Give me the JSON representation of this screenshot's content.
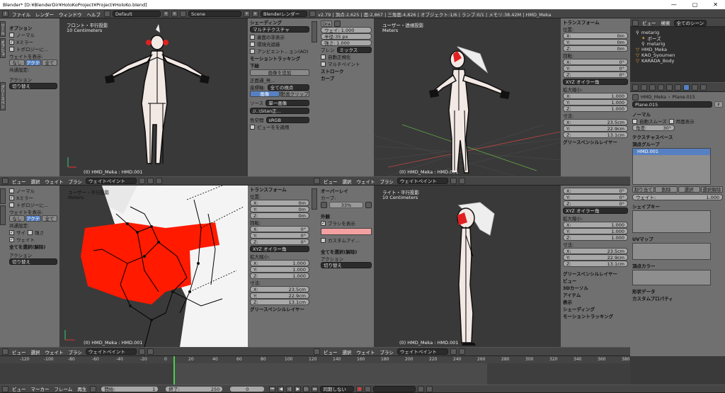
{
  "titlebar": {
    "title": "Blender* [D:¥BlenderDir¥HoloKoProject¥Project¥HoloKo.blend]"
  },
  "infobar": {
    "menus": [
      "ファイル",
      "レンダー",
      "ウィンドウ",
      "ヘルプ"
    ],
    "layout": "Default",
    "scene": "Scene",
    "engine": "Blenderレンダー",
    "stats": "v2.79 | 頂点:2,625 | 面:2,867 | 三角面:4,826 | オブジェクト:1/6 | ランプ:0/1 | メモリ:38.42M | HMD_Meka"
  },
  "tl_tools": {
    "tabs": [
      "ツール",
      "オプション",
      "グリースペンシル"
    ],
    "sec_options": "オプション",
    "normal": "ノーマル",
    "x_mirror": "Xミラー",
    "topology": "トポロジーに...",
    "weight_show": "ウェイトを表示:",
    "none": "なし",
    "active": "アクティブ",
    "all": "全て",
    "common": "共通設定:",
    "action": "アクション",
    "toggle": "切り替え"
  },
  "tl_view": {
    "title": "フロント・平行投影",
    "scale": "10 Centimeters",
    "obj": "(0) HMD_Meka : HMD.001"
  },
  "tm_tools": {
    "shading": "シェーディング",
    "multitex": "マルチテクスチャ",
    "backface": "裏面の非表示",
    "env": "環境光遮蔽",
    "ao": "アンビエント...ョン(AO)",
    "motion": "モーショントラッキング",
    "bg": "下絵",
    "add_image": "画像を追加",
    "front": "正面通_亮...",
    "axis": "座標軸:",
    "allview": "全ての視点",
    "img": "画像",
    "clip": "動画クリップ",
    "source": "ソース",
    "single": "単一画像",
    "path": "//..\\Sitan正...",
    "colorspace": "色空間",
    "srgb": "sRGB",
    "viewtransform": "ビューをを適用"
  },
  "tr_tools": {
    "d_label": "Dra",
    "weight": "ウェイ: 1.000",
    "radius": "半径:35 px",
    "strength": "強さ: 1.000",
    "blend": "ブレン",
    "mix": "ミックス",
    "auto_norm": "自動正規化",
    "multipaint": "マルチペイント",
    "stroke": "ストローク",
    "curve": "カーブ"
  },
  "tr_view": {
    "title": "ユーザー・透視投影",
    "scale": "Meters",
    "obj": "(0) HMD_Meka : HMD.001"
  },
  "bl_view": {
    "title": "ユーザー・平行投影",
    "scale": "Meters",
    "obj": "(0) HMD_Meka : HMD.001"
  },
  "br_view": {
    "title": "ライト・平行投影",
    "scale": "10 Centimeters",
    "obj": "(0) HMD_Meka : HMD.001"
  },
  "bl_tools": {
    "normal": "ノーマル",
    "x_mirror": "Xミラー",
    "topology": "トポロジーに...",
    "weight_show": "ウェイトを表示:",
    "none": "なし",
    "active": "アクティブ",
    "all": "全て",
    "common": "共通設定:",
    "size": "サイ",
    "strength": "強さ",
    "weight": "ウェイト",
    "select_all": "全てを選択(解除)",
    "action": "アクション",
    "toggle": "切り替え"
  },
  "br_tools": {
    "overlay": "オーバーレイ",
    "curve": "カーブ:",
    "pct": "33%",
    "appearance": "外観",
    "show_brush": "ブラシを表示",
    "custom_icon": "カスタムアイ...",
    "select_all": "全てを選択(解除)",
    "action": "アクション",
    "toggle": "切り替え"
  },
  "tf_upper": {
    "title": "トランスフォーム",
    "location": "位置:",
    "x": "0m",
    "y": "0m",
    "z": "0m",
    "rotation": "回転:",
    "rx": "0°",
    "ry": "0°",
    "rz": "0°",
    "mode": "XYZ オイラー角",
    "scale": "拡大縮小:",
    "sx": "1.000",
    "sy": "1.000",
    "sz": "1.000",
    "dims": "寸法:",
    "dx": "23.5cm",
    "dy": "22.9cm",
    "dz": "13.1cm",
    "gp": "グリースペンシルレイヤー"
  },
  "tf_lower": {
    "gp": "グリースペンシルレイヤー",
    "view": "ビュー",
    "cursor": "3Dカーソル",
    "item": "アイテム",
    "display": "表示",
    "shading": "シェーディング",
    "motion": "モーショントラッキング"
  },
  "viewport_hdr": {
    "menus": [
      "ビュー",
      "選択",
      "ウェイト",
      "ブラシ"
    ],
    "mode": "ウェイトペイント"
  },
  "outliner": {
    "view": "ビュー",
    "search": "検索",
    "all_scenes": "全てのシーン",
    "items": [
      "metarig",
      "ポーズ",
      "metarig",
      "HMD_Meka",
      "KAO_Syoumen",
      "KARADA_Body"
    ]
  },
  "props": {
    "obj": "HMD_Meka",
    "mesh": "Plane.015",
    "meshname": "Plane.015",
    "normal": "ノーマル",
    "autosmooth": "自動スムーズ",
    "double": "両面表示",
    "angle": "角度:",
    "angle_val": "30°",
    "texspace": "テクスチャスペース",
    "vgroups": "頂点グループ",
    "vg_item": "HMD.001",
    "assign": "割り当て",
    "remove": "削除",
    "select": "選択",
    "deselect": "選択解除",
    "weight": "ウェイト:",
    "weight_val": "1.000",
    "shapekeys": "シェイプキー",
    "uvmaps": "UVマップ",
    "vcolors": "頂点カラー",
    "geodata": "形状データ",
    "custom": "カスタムプロパティ"
  },
  "timeline": {
    "ticks": [
      "-120",
      "-100",
      "-80",
      "-60",
      "-40",
      "-20",
      "0",
      "20",
      "40",
      "60",
      "80",
      "100",
      "120",
      "140",
      "160",
      "180",
      "200",
      "220",
      "240",
      "260",
      "280",
      "300",
      "320",
      "340",
      "360",
      "380"
    ],
    "menus": [
      "ビュー",
      "マーカー",
      "フレーム",
      "再生"
    ],
    "start": "開始:",
    "start_val": "1",
    "end": "終了:",
    "end_val": "250",
    "cur": "0",
    "sync": "同期しない"
  }
}
